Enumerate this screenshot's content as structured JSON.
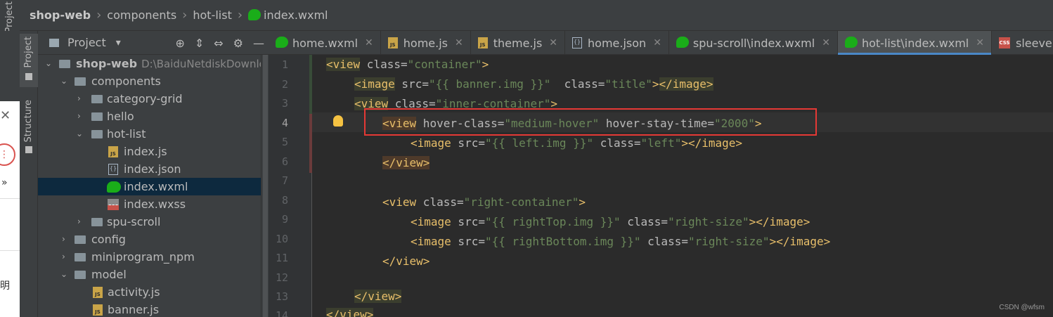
{
  "breadcrumb": {
    "items": [
      "shop-web",
      "components",
      "hot-list",
      "index.wxml"
    ]
  },
  "side_tabs": {
    "top": "Project",
    "project": "Project",
    "structure_top": "Structure",
    "structure": "Structure"
  },
  "overlay": {
    "close_glyph": "✕",
    "more_glyph": "⋮",
    "raquo_glyph": "»",
    "cn_char": "明"
  },
  "project_panel": {
    "title": "Project",
    "dropdown_glyph": "▾",
    "tools": [
      "⊕",
      "⇕",
      "⇔",
      "⚙",
      "—"
    ]
  },
  "tree": [
    {
      "label": "shop-web",
      "path": "D:\\BaiduNetdiskDownload",
      "bold": true
    },
    {
      "label": "components"
    },
    {
      "label": "category-grid"
    },
    {
      "label": "hello"
    },
    {
      "label": "hot-list"
    },
    {
      "label": "index.js"
    },
    {
      "label": "index.json"
    },
    {
      "label": "index.wxml"
    },
    {
      "label": "index.wxss"
    },
    {
      "label": "spu-scroll"
    },
    {
      "label": "config"
    },
    {
      "label": "miniprogram_npm"
    },
    {
      "label": "model"
    },
    {
      "label": "activity.js"
    },
    {
      "label": "banner.js"
    }
  ],
  "tabs": [
    {
      "label": "home.wxml"
    },
    {
      "label": "home.js"
    },
    {
      "label": "theme.js"
    },
    {
      "label": "home.json"
    },
    {
      "label": "spu-scroll\\index.wxml"
    },
    {
      "label": "hot-list\\index.wxml"
    },
    {
      "label": "sleeve.wxss"
    }
  ],
  "icons": {
    "js": "JS",
    "json": "{}",
    "css": "CSS",
    "close": "✕",
    "expanded": "⌄",
    "collapsed": "›"
  },
  "line_numbers": [
    "1",
    "2",
    "3",
    "4",
    "5",
    "6",
    "7",
    "8",
    "9",
    "10",
    "11",
    "12",
    "13",
    "14"
  ],
  "code": {
    "l1": {
      "open": "<view",
      "a1": " class=",
      "s1": "\"container\"",
      "close": ">"
    },
    "l2": {
      "open": "<image",
      "a1": " src=",
      "s1": "\"{{ banner.img }}\"",
      "a2": "  class=",
      "s2": "\"title\"",
      "gt": ">",
      "end": "</image>"
    },
    "l3": {
      "open": "<view",
      "a1": " class=",
      "s1": "\"inner-container\"",
      "close": ">"
    },
    "l4": {
      "open": "<view",
      "a1": " hover-class=",
      "s1": "\"medium-hover\"",
      "a2": " hover-stay-time=",
      "s2": "\"2000\"",
      "close": ">"
    },
    "l5": {
      "open": "<image",
      "a1": " src=",
      "s1": "\"{{ left.img }}\"",
      "a2": " class=",
      "s2": "\"left\"",
      "gt": ">",
      "end": "</image>"
    },
    "l6": {
      "end": "</view>"
    },
    "l8": {
      "open": "<view",
      "a1": " class=",
      "s1": "\"right-container\"",
      "close": ">"
    },
    "l9": {
      "open": "<image",
      "a1": " src=",
      "s1": "\"{{ rightTop.img }}\"",
      "a2": " class=",
      "s2": "\"right-size\"",
      "gt": ">",
      "end": "</image>"
    },
    "l10": {
      "open": "<image",
      "a1": " src=",
      "s1": "\"{{ rightBottom.img }}\"",
      "a2": " class=",
      "s2": "\"right-size\"",
      "gt": ">",
      "end": "</image>"
    },
    "l11": {
      "end": "</view>"
    },
    "l13": {
      "end": "</view>"
    },
    "l14": {
      "end": "</view>"
    }
  },
  "watermark": "CSDN @wfsm",
  "colors": {
    "accent": "#4a88c7",
    "highlight_box": "#e53935",
    "wechat": "#1aad19"
  }
}
